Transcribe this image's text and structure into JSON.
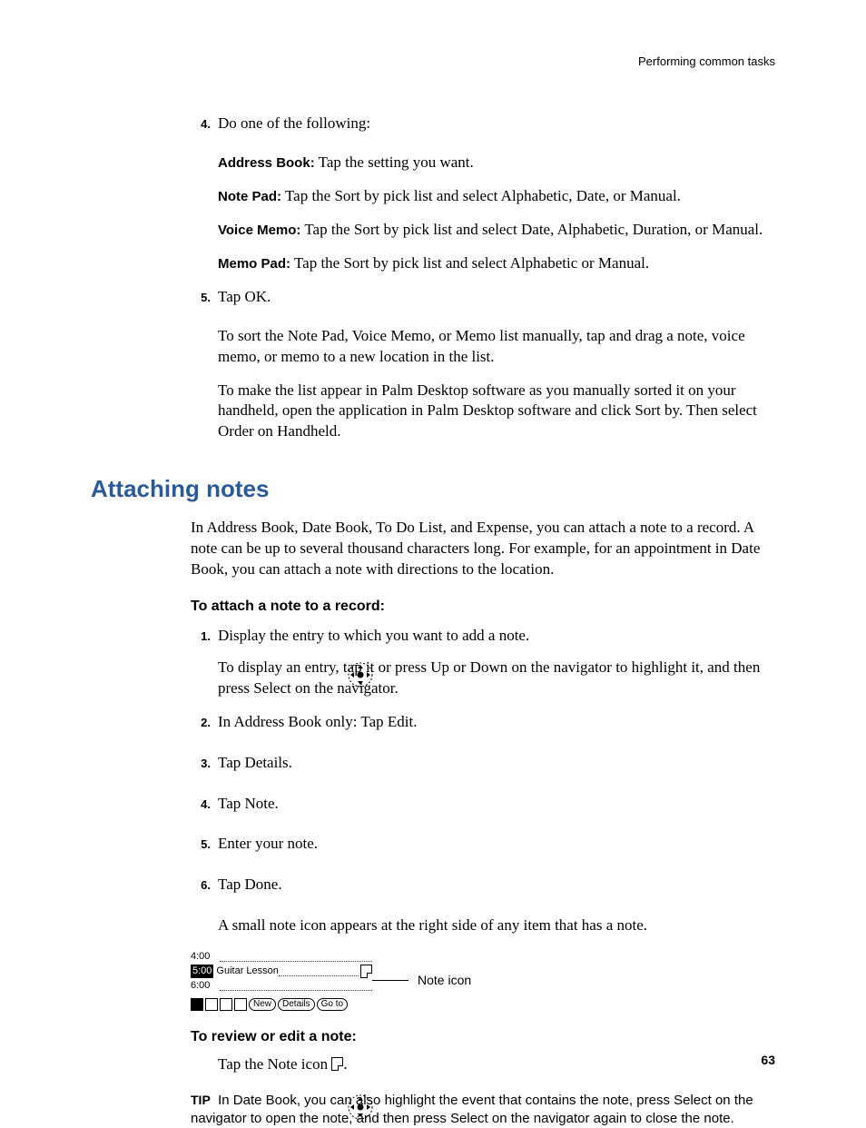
{
  "running_head": "Performing common tasks",
  "page_number": "63",
  "step4": {
    "num": "4.",
    "lead": "Do one of the following:",
    "address_label": "Address Book:",
    "address_text": " Tap the setting you want.",
    "notepad_label": "Note Pad:",
    "notepad_text": " Tap the Sort by pick list and select Alphabetic, Date, or Manual.",
    "voicememo_label": "Voice Memo:",
    "voicememo_text": " Tap the Sort by pick list and select Date, Alphabetic, Duration, or Manual.",
    "memopad_label": "Memo Pad:",
    "memopad_text": " Tap the Sort by pick list and select Alphabetic or Manual."
  },
  "step5": {
    "num": "5.",
    "lead": "Tap OK.",
    "p1": "To sort the Note Pad, Voice Memo, or Memo list manually, tap and drag a note, voice memo, or memo to a new location in the list.",
    "p2": "To make the list appear in Palm Desktop software as you manually sorted it on your handheld, open the application in Palm Desktop software and click Sort by. Then select Order on Handheld."
  },
  "section": {
    "heading": "Attaching notes",
    "intro": "In Address Book, Date Book, To Do List, and Expense, you can attach a note to a record. A note can be up to several thousand characters long. For example, for an appointment in Date Book, you can attach a note with directions to the location.",
    "sub1": "To attach a note to a record:",
    "attach": {
      "s1_num": "1.",
      "s1": "Display the entry to which you want to add a note.",
      "nav_note": "To display an entry, tap it or press Up or Down on the navigator to highlight it, and then press Select on the navigator.",
      "s2_num": "2.",
      "s2": "In Address Book only: Tap Edit.",
      "s3_num": "3.",
      "s3": "Tap Details.",
      "s4_num": "4.",
      "s4": "Tap Note.",
      "s5_num": "5.",
      "s5": "Enter your note.",
      "s6_num": "6.",
      "s6": "Tap Done.",
      "result": "A small note icon appears at the right side of any item that has a note."
    },
    "figure": {
      "time_400": "4:00",
      "time_500": "5:00",
      "entry_500": "Guitar Lesson",
      "time_600": "6:00",
      "btn_new": "New",
      "btn_details": "Details",
      "btn_goto": "Go to",
      "callout": "Note icon"
    },
    "sub2": "To review or edit a note:",
    "review_text_a": "Tap the Note icon ",
    "review_text_b": ".",
    "tip_label": "TIP",
    "tip_text": "In Date Book, you can also highlight the event that contains the note, press Select on the navigator to open the note, and then press Select on the navigator again to close the note."
  }
}
